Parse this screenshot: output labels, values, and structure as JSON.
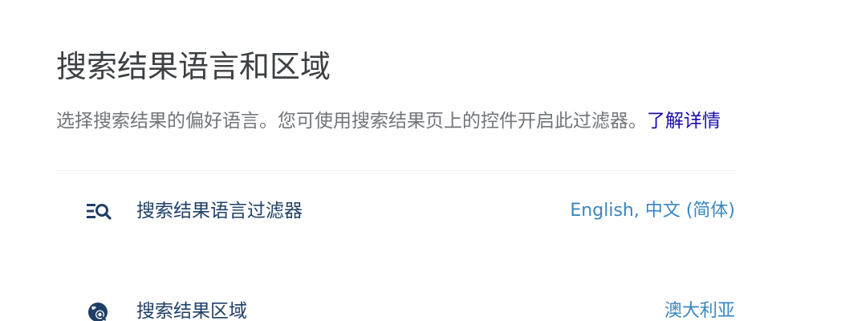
{
  "page": {
    "title": "搜索结果语言和区域",
    "description": "选择搜索结果的偏好语言。您可使用搜索结果页上的控件开启此过滤器。",
    "learn_more": "了解详情"
  },
  "settings": [
    {
      "icon": "language-filter-icon",
      "label": "搜索结果语言过滤器",
      "value": "English, 中文 (简体)"
    },
    {
      "icon": "globe-search-icon",
      "label": "搜索结果区域",
      "value": "澳大利亚"
    }
  ],
  "colors": {
    "title": "#3c4043",
    "description": "#70757a",
    "link": "#1a0dab",
    "label": "#1f3f66",
    "value": "#3a86c0"
  }
}
